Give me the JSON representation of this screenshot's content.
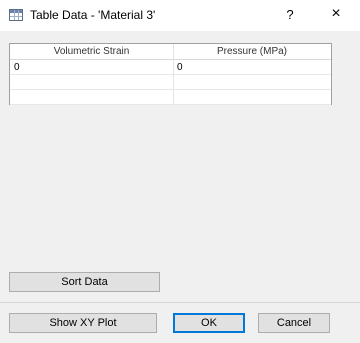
{
  "window": {
    "title": "Table Data - 'Material 3'",
    "help_label": "?",
    "close_label": "×"
  },
  "table": {
    "columns": [
      "Volumetric Strain",
      "Pressure (MPa)"
    ],
    "rows": [
      [
        "0",
        "0"
      ],
      [
        "",
        ""
      ],
      [
        "",
        ""
      ]
    ]
  },
  "buttons": {
    "sort_data": "Sort Data",
    "show_xy_plot": "Show XY Plot",
    "ok": "OK",
    "cancel": "Cancel"
  },
  "colors": {
    "window_bg": "#f0f0f0",
    "default_button_border": "#0078d7"
  }
}
